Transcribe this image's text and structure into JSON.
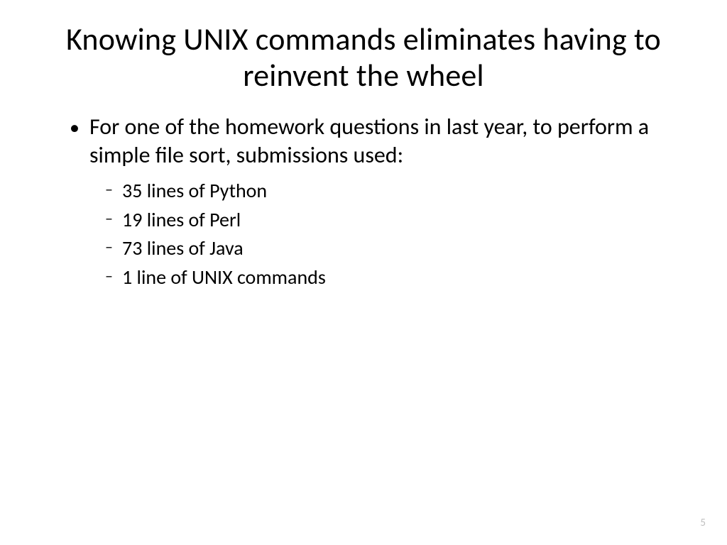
{
  "title": "Knowing UNIX commands eliminates having to reinvent the wheel",
  "bullets": {
    "main": "For one of the homework questions in last year, to perform a simple file sort, submissions used:",
    "sub": [
      "35 lines of Python",
      "19 lines of Perl",
      "73 lines of Java",
      "1 line of UNIX commands"
    ]
  },
  "pageNumber": "5"
}
